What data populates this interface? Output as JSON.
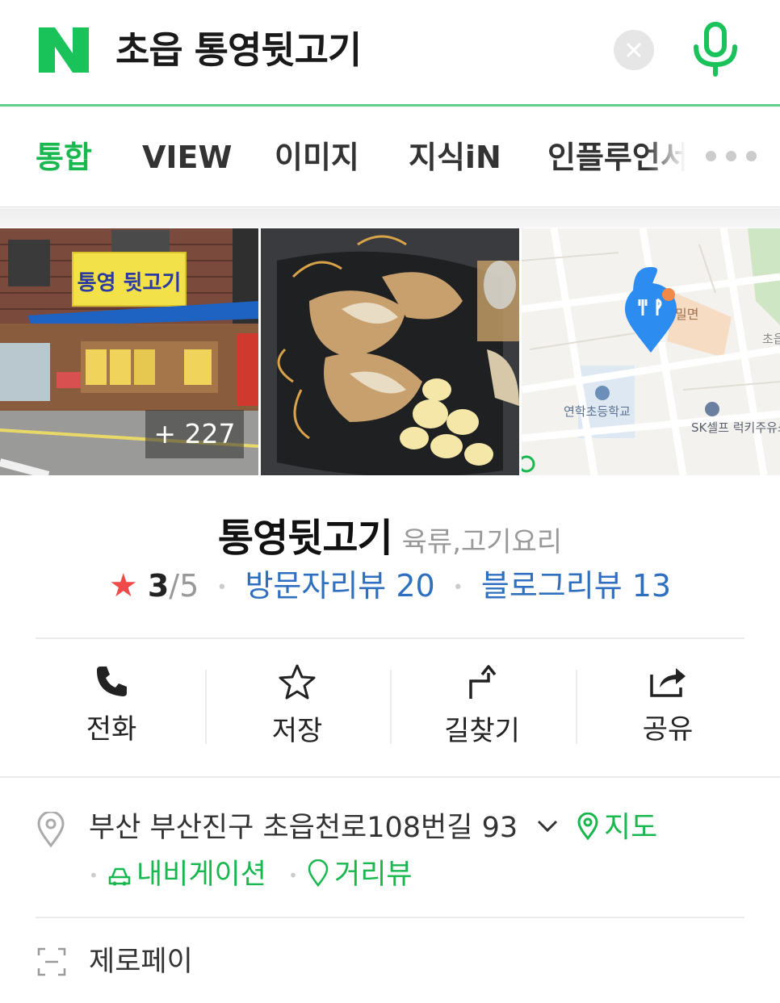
{
  "search": {
    "query": "초읍 통영뒷고기",
    "brand_color": "#19b84f"
  },
  "tabs": [
    {
      "label": "통합",
      "active": true
    },
    {
      "label": "VIEW",
      "active": false
    },
    {
      "label": "이미지",
      "active": false
    },
    {
      "label": "지식iN",
      "active": false
    },
    {
      "label": "인플루언서",
      "active": false
    }
  ],
  "photos": {
    "more_count": "+ 227",
    "items": [
      {
        "kind": "storefront",
        "sign_text": "통영 뒷고기"
      },
      {
        "kind": "food",
        "sign_text": ""
      },
      {
        "kind": "map",
        "sign_text": ""
      }
    ],
    "map_labels": {
      "school": "연학초등학교",
      "gas_station": "SK셀프 럭키주유소",
      "district_right": "초읍",
      "poi_top": "밀면"
    }
  },
  "place": {
    "name": "통영뒷고기",
    "category": "육류,고기요리",
    "rating_score": "3",
    "rating_max": "/5",
    "visitor_reviews": "방문자리뷰 20",
    "blog_reviews": "블로그리뷰 13"
  },
  "actions": [
    {
      "label": "전화",
      "icon": "phone-icon"
    },
    {
      "label": "저장",
      "icon": "star-outline-icon"
    },
    {
      "label": "길찾기",
      "icon": "directions-icon"
    },
    {
      "label": "공유",
      "icon": "share-icon"
    }
  ],
  "address": {
    "text": "부산 부산진구 초읍천로108번길 93",
    "map_link": "지도",
    "navigation_link": "내비게이션",
    "street_view_link": "거리뷰"
  },
  "payment": {
    "label": "제로페이"
  },
  "colors": {
    "accent_green": "#19b84f",
    "link_blue": "#2f6fc0",
    "rating_star": "#f04a4a"
  }
}
